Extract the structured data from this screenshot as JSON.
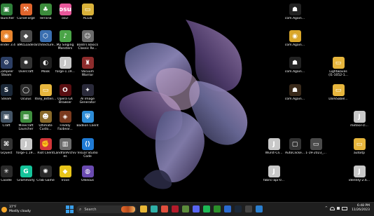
{
  "desktop": {
    "icons": [
      {
        "label": "Tlauncher",
        "text": "▣",
        "color": "#2f7f3a"
      },
      {
        "label": "CurseForge",
        "text": "⚒",
        "color": "#e0652d"
      },
      {
        "label": "Terraria",
        "text": "♣",
        "color": "#3c8c3c"
      },
      {
        "label": "osu!",
        "text": "osu",
        "color": "#e8579b"
      },
      {
        "label": "ACLib",
        "text": "▭",
        "color": "#d9b23a"
      },
      {
        "label": "Blender 3.4",
        "text": "◉",
        "color": "#e8852f"
      },
      {
        "label": "BMcLoader",
        "text": "◆",
        "color": "#4b4b4b"
      },
      {
        "label": "architecture...",
        "text": "⬡",
        "color": "#3a6fb0"
      },
      {
        "label": "My Singing Monsters",
        "text": "♪",
        "color": "#4aa447"
      },
      {
        "label": "Baldi's Basics Classic Re...",
        "text": "☺",
        "color": "#6b6b6b"
      },
      {
        "label": "Compiler Steam",
        "text": "⚙",
        "color": "#2c3e63"
      },
      {
        "label": "Overcraft",
        "text": "✸",
        "color": "#333333"
      },
      {
        "label": "Mook",
        "text": "◐",
        "color": "#1e1e1e"
      },
      {
        "label": "forge-1.19...",
        "text": "J",
        "color": "#c8c8c8"
      },
      {
        "label": "Vacuum Warrior",
        "text": "♜",
        "color": "#8d2c2c"
      },
      {
        "label": "Steam",
        "text": "S",
        "color": "#1b2838"
      },
      {
        "label": "Oculus",
        "text": "◯",
        "color": "#2b2b2b"
      },
      {
        "label": "Itsey_Bitten...",
        "text": "▭",
        "color": "#e7b63d"
      },
      {
        "label": "Opera GX Browser",
        "text": "O",
        "color": "#5a0f12"
      },
      {
        "label": "AI Image Generator",
        "text": "✦",
        "color": "#2a2a3a"
      },
      {
        "label": "Craft",
        "text": "▣",
        "color": "#445566"
      },
      {
        "label": "Minecraft Launcher",
        "text": "▦",
        "color": "#3f8f3f"
      },
      {
        "label": "Ultimate Custo...",
        "text": "☻",
        "color": "#8a6a2a"
      },
      {
        "label": "Freddy Fazbear...",
        "text": "◈",
        "color": "#7a3a1e"
      },
      {
        "label": "Badlion Client",
        "text": "⛨",
        "color": "#2d8cd6"
      },
      {
        "label": "GQuest",
        "text": "⌘",
        "color": "#333333"
      },
      {
        "label": "forge-1.19...",
        "text": "J",
        "color": "#c8c8c8"
      },
      {
        "label": "Riot Client",
        "text": "✊",
        "color": "#d13639"
      },
      {
        "label": "LandfallArchives",
        "text": "▥",
        "color": "#6b6b6b"
      },
      {
        "label": "Visual Studio Code",
        "text": "⟨⟩",
        "color": "#1f7ad4"
      },
      {
        "label": "Coodle",
        "text": "✳",
        "color": "#2a2a2a"
      },
      {
        "label": "Grammarly",
        "text": "G",
        "color": "#15c39a"
      },
      {
        "label": "Crab Game",
        "text": "✺",
        "color": "#2a2a2a"
      },
      {
        "label": "Trove",
        "text": "◆",
        "color": "#e8c51a"
      },
      {
        "label": "Ollieous",
        "text": "◍",
        "color": "#6a4ab0"
      },
      {
        "label": "com.Again...",
        "text": "☗",
        "color": "#222222"
      },
      {
        "label": "com.Again...",
        "text": "◉",
        "color": "#d9a62a"
      },
      {
        "label": "com.Again...",
        "text": "☗",
        "color": "#222222"
      },
      {
        "label": "Lightwaves (I1-1052-1...",
        "text": "▭",
        "color": "#e7b63d"
      },
      {
        "label": "com.Again...",
        "text": "☗",
        "color": "#3a2a1a"
      },
      {
        "label": "DarkSabel...",
        "text": "▭",
        "color": "#e7b63d"
      },
      {
        "label": "meteor-cl...",
        "text": "J",
        "color": "#c8c8c8"
      },
      {
        "label": "Wurst-Cli...",
        "text": "J",
        "color": "#c8c8c8"
      },
      {
        "label": "AutoClicke...",
        "text": "▢",
        "color": "#333333"
      },
      {
        "label": "1-19-2023_...",
        "text": "▭",
        "color": "#4a4a4a"
      },
      {
        "label": "autoitp",
        "text": "▭",
        "color": "#e7b63d"
      },
      {
        "label": "fabric-api-0...",
        "text": "J",
        "color": "#c8c8c8"
      },
      {
        "label": "identity-2.6...",
        "text": "J",
        "color": "#c8c8c8"
      }
    ]
  },
  "taskbar": {
    "weather_temp": "37°F",
    "weather_desc": "Mostly cloudy",
    "search_label": "Search",
    "apps": [
      {
        "name": "file-explorer",
        "color": "#e8b737"
      },
      {
        "name": "edge",
        "color": "#2fb0a8"
      },
      {
        "name": "chrome",
        "color": "#e04f3d"
      },
      {
        "name": "opera-gx",
        "color": "#b31b2a"
      },
      {
        "name": "minecraft",
        "color": "#5c8c3c"
      },
      {
        "name": "discord",
        "color": "#5865f2"
      },
      {
        "name": "spotify",
        "color": "#1db954"
      },
      {
        "name": "xbox",
        "color": "#2a8f2a"
      },
      {
        "name": "store",
        "color": "#2a6ad0"
      },
      {
        "name": "steam",
        "color": "#1b2838"
      },
      {
        "name": "terminal",
        "color": "#444444"
      },
      {
        "name": "photos",
        "color": "#2a7fd0"
      }
    ],
    "time": "6:48 PM",
    "date": "11/26/2023"
  }
}
